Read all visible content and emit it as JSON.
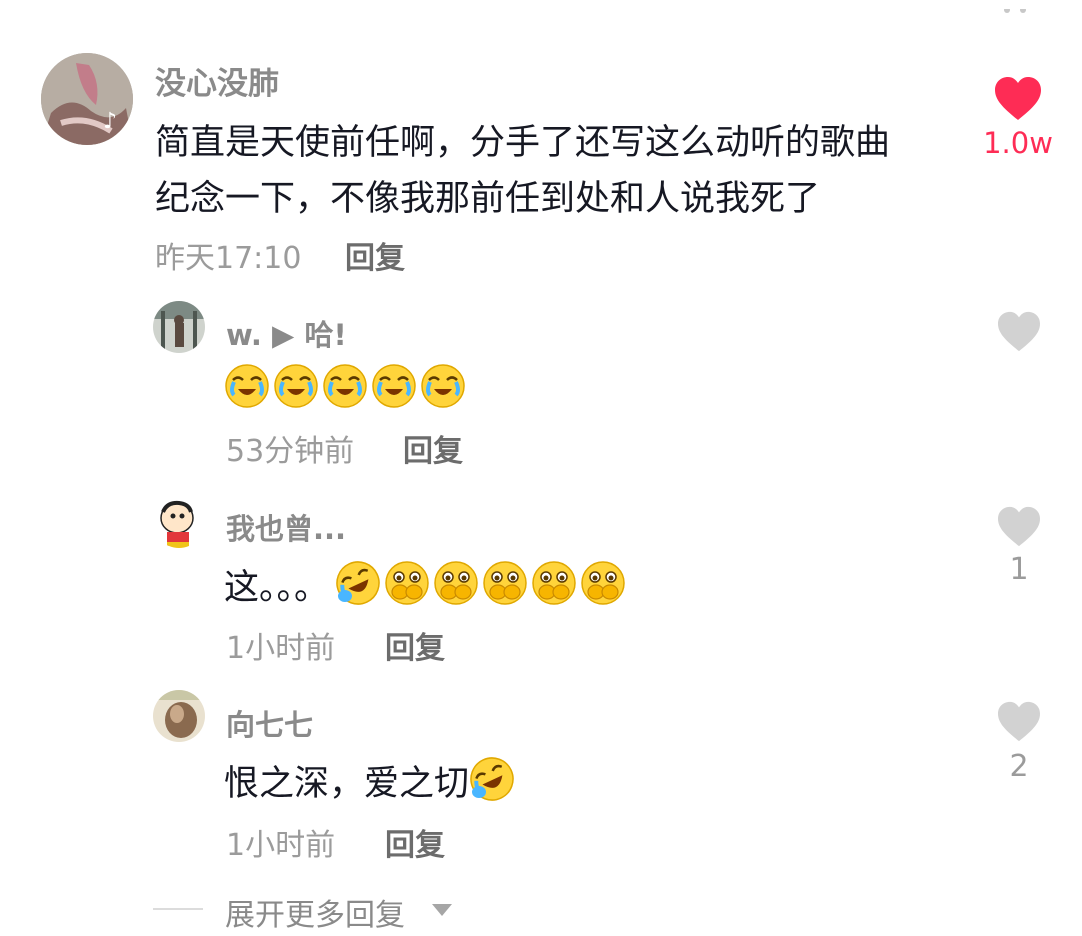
{
  "main_comment": {
    "username": "没心没肺",
    "line1": "简直是天使前任啊，分手了还写这么动听的歌曲",
    "line2": "纪念一下，不像我那前任到处和人说我死了",
    "time": "昨天17:10",
    "reply_label": "回复",
    "likes": "1.0w",
    "liked": true
  },
  "replies": [
    {
      "username": "w. ▶ 哈!",
      "text": "",
      "emojis": [
        "laugh-cry",
        "laugh-cry",
        "laugh-cry",
        "laugh-cry",
        "laugh-cry"
      ],
      "time": "53分钟前",
      "reply_label": "回复",
      "likes": ""
    },
    {
      "username": "我也曾...",
      "text": "这。。。",
      "emojis": [
        "rofl",
        "covering-mouth",
        "covering-mouth",
        "covering-mouth",
        "covering-mouth",
        "covering-mouth"
      ],
      "time": "1小时前",
      "reply_label": "回复",
      "likes": "1"
    },
    {
      "username": "向七七",
      "text": "恨之深，爱之切",
      "emojis": [
        "rofl"
      ],
      "time": "1小时前",
      "reply_label": "回复",
      "likes": "2"
    }
  ],
  "expand_label": "展开更多回复",
  "colors": {
    "liked_heart": "#fe2c55",
    "unliked_heart": "#d2d2d2",
    "name": "#8a8a8a",
    "text": "#161823",
    "meta": "#9b9b9b"
  }
}
